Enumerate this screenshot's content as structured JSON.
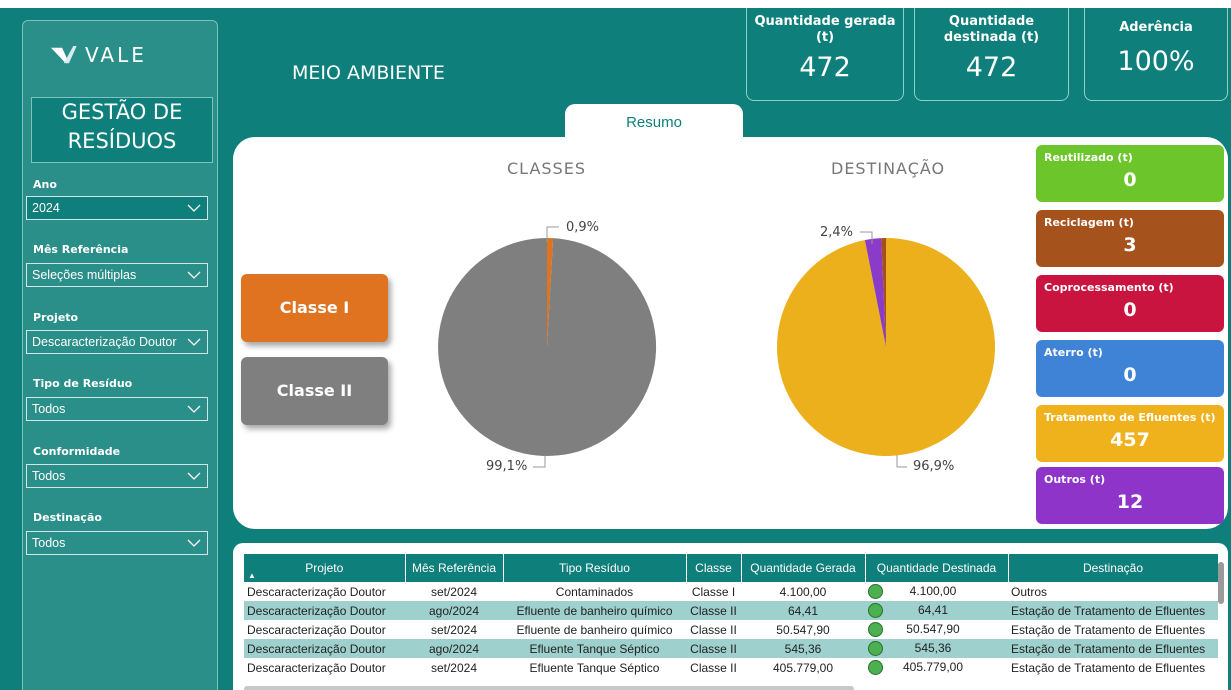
{
  "sidebar": {
    "logo_text": "VALE",
    "title": "GESTÃO DE RESÍDUOS",
    "filters": [
      {
        "label": "Ano",
        "value": "2024"
      },
      {
        "label": "Mês Referência",
        "value": "Seleções múltiplas"
      },
      {
        "label": "Projeto",
        "value": "Descaracterização Doutor"
      },
      {
        "label": "Tipo de Resíduo",
        "value": "Todos"
      },
      {
        "label": "Conformidade",
        "value": "Todos"
      },
      {
        "label": "Destinação",
        "value": "Todos"
      }
    ]
  },
  "header": {
    "title": "MEIO AMBIENTE",
    "kpis": [
      {
        "label": "Quantidade gerada (t)",
        "value": "472"
      },
      {
        "label": "Quantidade destinada (t)",
        "value": "472"
      },
      {
        "label": "Aderência",
        "value": "100%"
      }
    ]
  },
  "tab": {
    "label": "Resumo"
  },
  "classes": {
    "title": "CLASSES",
    "buttons": [
      {
        "label": "Classe I",
        "color": "#e07320"
      },
      {
        "label": "Classe II",
        "color": "#7f7f7f"
      }
    ]
  },
  "destinacao": {
    "title": "DESTINAÇÃO"
  },
  "chart_data": [
    {
      "type": "pie",
      "title": "CLASSES",
      "categories": [
        "Classe I",
        "Classe II"
      ],
      "values": [
        0.9,
        99.1
      ],
      "labels": [
        "0,9%",
        "99,1%"
      ],
      "colors": [
        "#e07320",
        "#7f7f7f"
      ]
    },
    {
      "type": "pie",
      "title": "DESTINAÇÃO",
      "categories": [
        "Tratamento de Efluentes",
        "Outros",
        "Reciclagem"
      ],
      "values": [
        96.9,
        2.4,
        0.7
      ],
      "labels": [
        "96,9%",
        "2,4%"
      ],
      "colors": [
        "#ecb01c",
        "#8a3bc7",
        "#a44f1c"
      ]
    }
  ],
  "destination_cards": [
    {
      "label": "Reutilizado (t)",
      "value": "0",
      "color": "#6cc62b"
    },
    {
      "label": "Reciclagem (t)",
      "value": "3",
      "color": "#a5521c"
    },
    {
      "label": "Coprocessamento (t)",
      "value": "0",
      "color": "#c8143f"
    },
    {
      "label": "Aterro (t)",
      "value": "0",
      "color": "#3f83d6"
    },
    {
      "label": "Tratamento de Efluentes (t)",
      "value": "457",
      "color": "#f0b21c"
    },
    {
      "label": "Outros (t)",
      "value": "12",
      "color": "#8e34c9"
    }
  ],
  "table": {
    "columns": [
      "Projeto",
      "Mês Referência",
      "Tipo Resíduo",
      "Classe",
      "Quantidade Gerada",
      "Quantidade Destinada",
      "Destinação"
    ],
    "rows": [
      [
        "Descaracterização Doutor",
        "set/2024",
        "Contaminados",
        "Classe I",
        "4.100,00",
        "4.100,00",
        "Outros"
      ],
      [
        "Descaracterização Doutor",
        "ago/2024",
        "Efluente de banheiro químico",
        "Classe II",
        "64,41",
        "64,41",
        "Estação de Tratamento de Efluentes"
      ],
      [
        "Descaracterização Doutor",
        "set/2024",
        "Efluente de banheiro químico",
        "Classe II",
        "50.547,90",
        "50.547,90",
        "Estação de Tratamento de Efluentes"
      ],
      [
        "Descaracterização Doutor",
        "ago/2024",
        "Efluente Tanque Séptico",
        "Classe II",
        "545,36",
        "545,36",
        "Estação de Tratamento de Efluentes"
      ],
      [
        "Descaracterização Doutor",
        "set/2024",
        "Efluente Tanque Séptico",
        "Classe II",
        "405.779,00",
        "405.779,00",
        "Estação de Tratamento de Efluentes"
      ]
    ]
  }
}
